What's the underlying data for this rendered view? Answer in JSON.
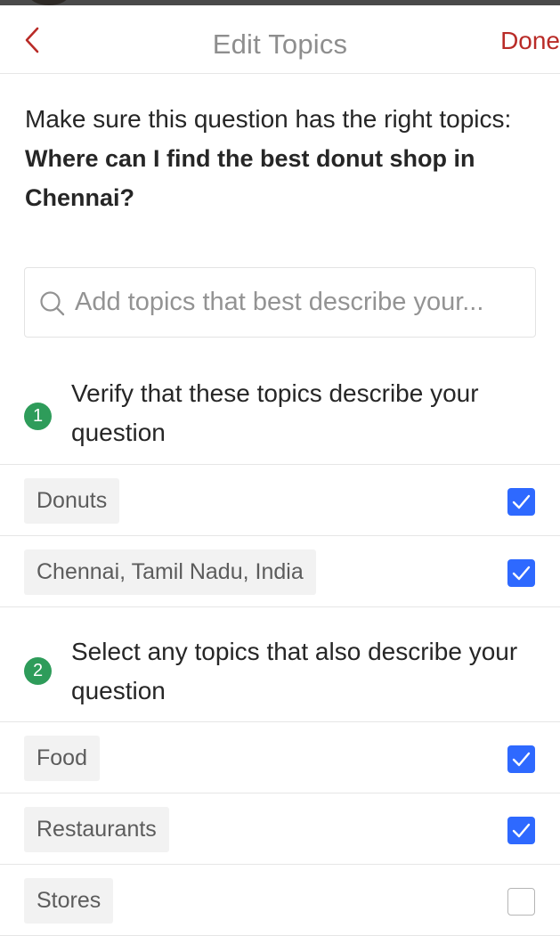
{
  "header": {
    "title": "Edit Topics",
    "back_icon": "chevron-left-icon",
    "done_label": "Done"
  },
  "intro": {
    "prompt": "Make sure this question has the right topics:",
    "question": "Where can I find the best donut shop in Chennai?"
  },
  "search": {
    "icon": "search-icon",
    "placeholder": "Add topics that best describe your...",
    "value": ""
  },
  "sections": [
    {
      "step": "1",
      "heading": "Verify that these topics describe your question",
      "topics": [
        {
          "label": "Donuts",
          "checked": true
        },
        {
          "label": "Chennai, Tamil Nadu, India",
          "checked": true
        }
      ]
    },
    {
      "step": "2",
      "heading": "Select any topics that also describe your question",
      "topics": [
        {
          "label": "Food",
          "checked": true
        },
        {
          "label": "Restaurants",
          "checked": true
        },
        {
          "label": "Stores",
          "checked": false
        }
      ]
    }
  ],
  "colors": {
    "accent_red": "#b92b27",
    "step_green": "#2e9c5a",
    "checkbox_blue": "#2e69ff",
    "title_gray": "#8e8e8e"
  }
}
